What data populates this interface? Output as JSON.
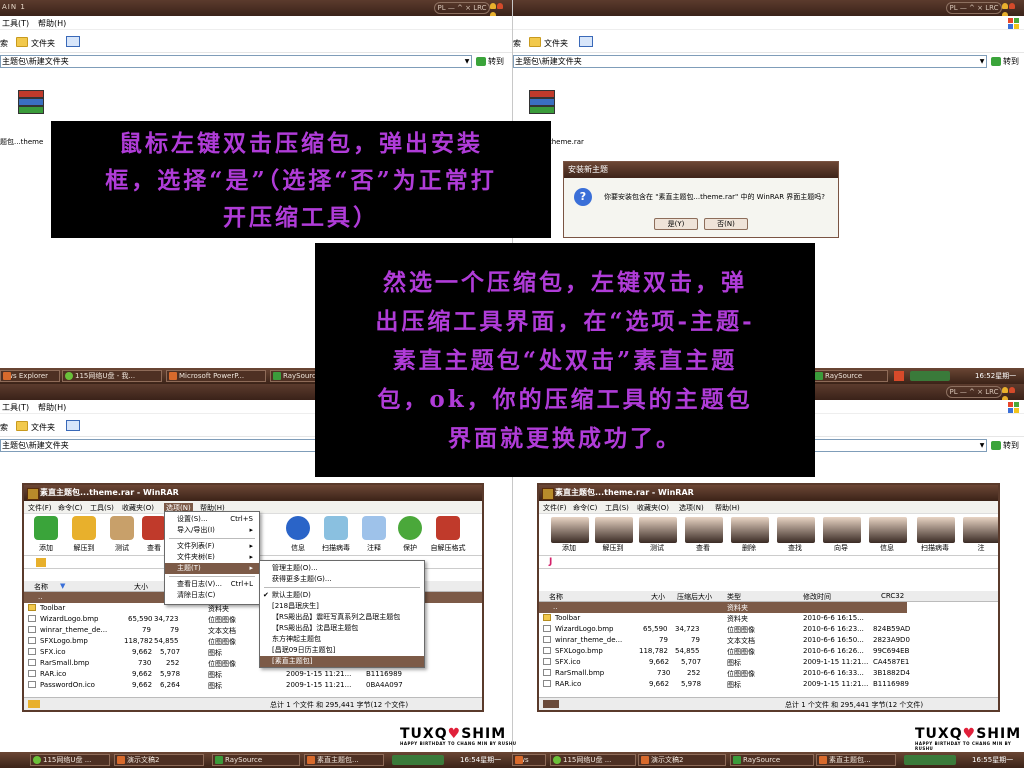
{
  "explorer": {
    "title_tl": "AIN 1",
    "title_controls": "PL — ^ × LRC",
    "menu_tools": "工具(T)",
    "menu_help": "帮助(H)",
    "toolbar_folders": "文件夹",
    "toolbar_leftstub": "索",
    "address": "主题包\\新建文件夹",
    "go": "转到",
    "file_label_tl": "题包...theme",
    "file_label_tr": "theme.rar"
  },
  "instructions": {
    "box1_lines": [
      "鼠标左键双击压缩包，弹出安装",
      "框，选择“是”（选择“否”为正常打",
      "开压缩工具）"
    ],
    "box2_lines": [
      "然选一个压缩包，左键双击，弹",
      "出压缩工具界面，在“选项-主题-",
      "素直主题包“处双击”素直主题",
      "包，ok，你的压缩工具的主题包",
      "界面就更换成功了。"
    ]
  },
  "dialog": {
    "title": "安装新主题",
    "message": "你要安装包含在 \"素直主题包...theme.rar\" 中的 WinRAR 界面主题吗?",
    "yes": "是(Y)",
    "no": "否(N)"
  },
  "taskbar_mid": {
    "items": [
      "ows Explorer",
      "115网络U盘 - 我...",
      "Microsoft PowerP...",
      "RaySource",
      "RaySource"
    ],
    "tray_time": "16:52",
    "tray_tail": "星期一"
  },
  "taskbar_bottom": {
    "items_left": [
      "115网络U盘 ...",
      "演示文稿2",
      "RaySource",
      "素直主题包..."
    ],
    "time_left": "16:54",
    "day_left": "星期一",
    "items_right": [
      "ows",
      "115网络U盘 ...",
      "演示文稿2",
      "RaySource",
      "素直主题包..."
    ],
    "time_right": "16:55",
    "day_right": "星期一"
  },
  "winrar": {
    "title": "素直主题包...theme.rar - WinRAR",
    "menu": [
      "文件(F)",
      "命令(C)",
      "工具(S)",
      "收藏夹(O)",
      "选项(N)",
      "帮助(H)"
    ],
    "tools_left": [
      "添加",
      "解压到",
      "测试",
      "查看",
      "",
      "信息",
      "扫描病毒",
      "注释",
      "保护",
      "自解压格式"
    ],
    "tools_right": [
      "添加",
      "解压到",
      "测试",
      "查看",
      "删除",
      "查找",
      "向导",
      "信息",
      "扫描病毒",
      "注"
    ],
    "col_headers": [
      "名称",
      "大小",
      "压缩后大小",
      "类型",
      "修改时间",
      "CRC32"
    ],
    "rows": [
      {
        "name": "..",
        "size": "",
        "packed": "",
        "type": "资料夹",
        "time": "",
        "crc": ""
      },
      {
        "name": "Toolbar",
        "size": "",
        "packed": "",
        "type": "资料夹",
        "time": "",
        "crc": ""
      },
      {
        "name": "WizardLogo.bmp",
        "size": "65,590",
        "packed": "34,723",
        "type": "位图图像",
        "time": "2010-6-6 16:23...",
        "crc": "824B59AD"
      },
      {
        "name": "winrar_theme_de...",
        "size": "79",
        "packed": "79",
        "type": "文本文档",
        "time": "2010-6-6 16:50...",
        "crc": "2823A9D0"
      },
      {
        "name": "SFXLogo.bmp",
        "size": "118,782",
        "packed": "54,855",
        "type": "位图图像",
        "time": "2010-6-6 16:26...",
        "crc": "99C694EB"
      },
      {
        "name": "SFX.ico",
        "size": "9,662",
        "packed": "5,707",
        "type": "图标",
        "time": "2009-1-15 11:21...",
        "crc": "CA4587E1"
      },
      {
        "name": "RarSmall.bmp",
        "size": "730",
        "packed": "252",
        "type": "位图图像",
        "time": "2010-6-6 16:33...",
        "crc": "3B1882D4"
      },
      {
        "name": "RAR.ico",
        "size": "9,662",
        "packed": "5,978",
        "type": "图标",
        "time": "2009-1-15 11:21...",
        "crc": "B1116989"
      },
      {
        "name": "PasswordOn.ico",
        "size": "9,662",
        "packed": "6,264",
        "type": "图标",
        "time": "2009-1-15 11:21...",
        "crc": "0BA4A097"
      }
    ],
    "row1_time_right": "2010-6-6 16:15...",
    "status": "总计 1 个文件 和 295,441 字节(12 个文件)"
  },
  "options_menu": {
    "items": [
      "设置(S)...",
      "导入/导出(I)",
      "文件列表(F)",
      "文件夹树(E)",
      "主题(T)",
      "查看日志(V)...",
      "清除日志(C)"
    ],
    "shortcut_settings": "Ctrl+S",
    "shortcut_log": "Ctrl+L"
  },
  "themes_menu": {
    "items": [
      "管理主题(O)...",
      "获得更多主题(G)...",
      "默认主题(D)",
      "[218昌珉庆生]",
      "【RS殿出品】震旺写真系列之昌珉主题包",
      "【RS殿出品】沈昌珉主题包",
      "东方神起主题包",
      "[昌珉09日历主题包]",
      "[素直主题包]"
    ]
  },
  "watermark": {
    "name_a": "TUXQ",
    "name_b": "SHIM",
    "tagline": "HAPPY BIRTHDAY TO CHANG MIN BY RUSHU"
  }
}
